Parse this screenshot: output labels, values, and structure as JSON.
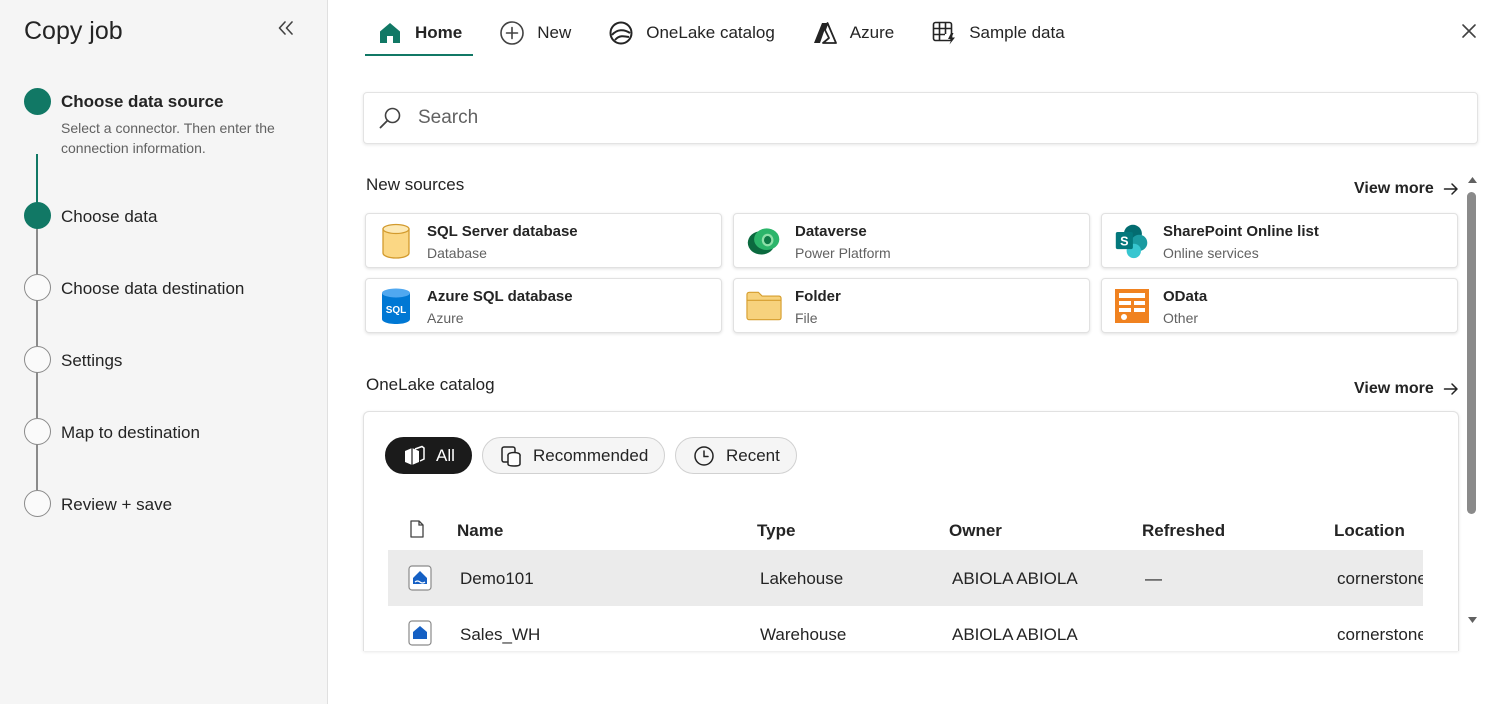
{
  "sidebar": {
    "title": "Copy job",
    "steps": [
      {
        "label": "Choose data source",
        "description": "Select a connector. Then enter the connection information."
      },
      {
        "label": "Choose data"
      },
      {
        "label": "Choose data destination"
      },
      {
        "label": "Settings"
      },
      {
        "label": "Map to destination"
      },
      {
        "label": "Review + save"
      }
    ]
  },
  "tabs": [
    {
      "label": "Home",
      "icon": "home-icon",
      "active": true
    },
    {
      "label": "New",
      "icon": "plus-circle-icon"
    },
    {
      "label": "OneLake catalog",
      "icon": "onelake-icon"
    },
    {
      "label": "Azure",
      "icon": "azure-icon"
    },
    {
      "label": "Sample data",
      "icon": "table-sparkle-icon"
    }
  ],
  "search": {
    "placeholder": "Search"
  },
  "new_sources": {
    "title": "New sources",
    "view_more": "View more",
    "cards": [
      {
        "title": "SQL Server database",
        "subtitle": "Database",
        "icon": "sql-server-icon"
      },
      {
        "title": "Dataverse",
        "subtitle": "Power Platform",
        "icon": "dataverse-icon"
      },
      {
        "title": "SharePoint Online list",
        "subtitle": "Online services",
        "icon": "sharepoint-icon"
      },
      {
        "title": "Azure SQL database",
        "subtitle": "Azure",
        "icon": "azure-sql-icon"
      },
      {
        "title": "Folder",
        "subtitle": "File",
        "icon": "folder-icon"
      },
      {
        "title": "OData",
        "subtitle": "Other",
        "icon": "odata-icon"
      }
    ]
  },
  "catalog": {
    "title": "OneLake catalog",
    "view_more": "View more",
    "filters": [
      {
        "label": "All",
        "active": true
      },
      {
        "label": "Recommended"
      },
      {
        "label": "Recent"
      }
    ],
    "columns": [
      "Name",
      "Type",
      "Owner",
      "Refreshed",
      "Location"
    ],
    "rows": [
      {
        "name": "Demo101",
        "type": "Lakehouse",
        "owner": "ABIOLA ABIOLA",
        "refreshed": "—",
        "location": "cornerstone",
        "selected": true
      },
      {
        "name": "Sales_WH",
        "type": "Warehouse",
        "owner": "ABIOLA ABIOLA",
        "refreshed": "",
        "location": "cornerstone"
      }
    ]
  },
  "colors": {
    "accent": "#117865",
    "step_inactive": "#8a8a8a",
    "sidebar_bg": "#f5f5f5",
    "selected_row": "#ebebeb"
  }
}
